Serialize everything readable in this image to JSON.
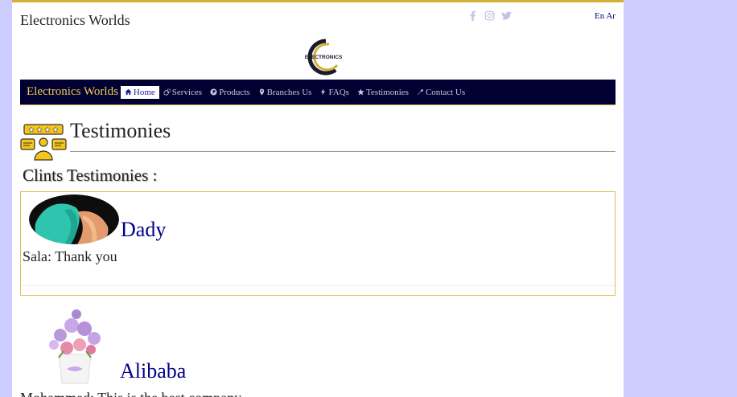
{
  "header": {
    "site_title": "Electronics Worlds",
    "lang_switch": "En Ar",
    "logo_text": "ELECTRONICS",
    "social": [
      "facebook-icon",
      "instagram-icon",
      "twitter-icon"
    ]
  },
  "nav": {
    "brand": "Electronics Worlds",
    "items": [
      {
        "label": "Home",
        "icon": "home-icon",
        "active": true
      },
      {
        "label": "Services",
        "icon": "gears-icon"
      },
      {
        "label": "Products",
        "icon": "product-hunt-icon"
      },
      {
        "label": "Branches Us",
        "icon": "map-marker-icon"
      },
      {
        "label": "FAQs",
        "icon": "bolt-icon"
      },
      {
        "label": "Testimonies",
        "icon": "star-icon"
      },
      {
        "label": "Contact Us",
        "icon": "wrench-icon"
      }
    ]
  },
  "page": {
    "title": "Testimonies",
    "section_heading": "Clints Testimonies :"
  },
  "testimonials": [
    {
      "name": "Dady",
      "quote": "Sala: Thank you"
    },
    {
      "name": "Alibaba",
      "quote": "Mohammed: This is the best company"
    }
  ],
  "colors": {
    "background": "#ccccff",
    "nav_bg": "#000033",
    "accent_gold": "#d4b038",
    "brand_yellow": "#f2c94c",
    "name_blue": "#00008b"
  }
}
